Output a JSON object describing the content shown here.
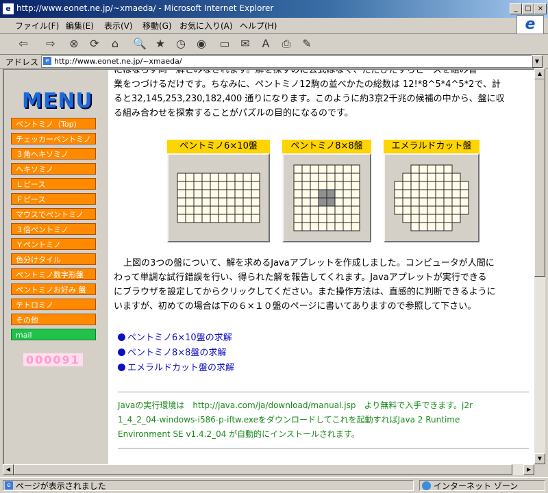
{
  "window": {
    "title": "http://www.eonet.ne.jp/~xmaeda/ - Microsoft Internet Explorer",
    "buttons": {
      "minimize": "_",
      "maximize": "□",
      "close": "×"
    }
  },
  "menubar": [
    "ファイル(F)",
    "編集(E)",
    "表示(V)",
    "移動(G)",
    "お気に入り(A)",
    "ヘルプ(H)"
  ],
  "toolbar": {
    "icons": [
      "back-icon",
      "forward-icon",
      "stop-icon",
      "refresh-icon",
      "home-icon",
      "search-icon",
      "favorites-icon",
      "history-icon",
      "channels-icon",
      "fullscreen-icon",
      "mail-icon",
      "font-icon",
      "print-icon",
      "edit-icon"
    ],
    "glyphs": [
      "⇦",
      "⇨",
      "⊗",
      "⟳",
      "⌂",
      "🔍",
      "★",
      "◷",
      "◉",
      "▭",
      "✉",
      "A",
      "⎙",
      "✎"
    ]
  },
  "address": {
    "label": "アドレス",
    "url": "http://www.eonet.ne.jp/~xmaeda/"
  },
  "sidebar": {
    "title": "MENU",
    "items": [
      "ペントミノ（Top)",
      "チェッカーペントミノ",
      "３角ヘキソミノ",
      "ヘキソミノ",
      "Ｌピース",
      "Ｆピース",
      "マウスでペントミノ",
      "３倍ペントミノ",
      "Ｙペントミノ",
      "色分けタイル",
      "ペントミノ数字形盤",
      "ペントミノお好み 盤",
      "テトロミノ",
      "その他",
      "mail"
    ],
    "counter": "000091"
  },
  "content": {
    "para1": [
      "にはならず同一解とみなされます。解を探すのに公式はなく、ただひたすらピースを組み替",
      "業をつづけるだけです。ちなみに、ペントミノ12駒の並べかたの総数は 12!*8^5*4^5*2で、計",
      "ると32,145,253,230,182,400 通りになります。このように約3京2千兆の候補の中から、盤に収",
      "る組み合わせを探索することがパズルの目的になるのです。"
    ],
    "boards": [
      {
        "label": "ペントミノ6×10盤",
        "cols": 10,
        "rows": 6
      },
      {
        "label": "ペントミノ8×8盤",
        "cols": 8,
        "rows": 8
      },
      {
        "label": "エメラルドカット盤",
        "cols": 9,
        "rows": 8
      }
    ],
    "para2": [
      "上図の3つの盤について、解を求めるJavaアプレットを作成しました。コンピュータが人間に",
      "わって単調な試行錯誤を行い、得られた解を報告してくれます。Javaアプレットが実行できる",
      "にブラウザを設定してからクリックしてください。また操作方法は、直感的に判断できるように",
      "いますが、初めての場合は下の６×１０盤のページに書いてありますので参照して下さい。"
    ],
    "links": [
      "ペントミノ6×10盤の求解",
      "ペントミノ8×8盤の求解",
      "エメラルドカット盤の求解"
    ],
    "java_note": [
      "Javaの実行環境は　http://java.com/ja/download/manual.jsp　より無料で入手できます。j2r",
      "1_4_2_04-windows-i586-p-iftw.exeをダウンロードしてこれを起動すればJava 2 Runtime",
      "Environment SE v1.4.2_04 が自動的にインストールされます。"
    ]
  },
  "statusbar": {
    "text": "ページが表示されました",
    "zone": "インターネット ゾーン"
  },
  "colors": {
    "nav": "#ff8a00",
    "mail": "#22c24a",
    "board_label": "#ffd400",
    "link": "#1010c0",
    "note": "#1a8a1a"
  }
}
